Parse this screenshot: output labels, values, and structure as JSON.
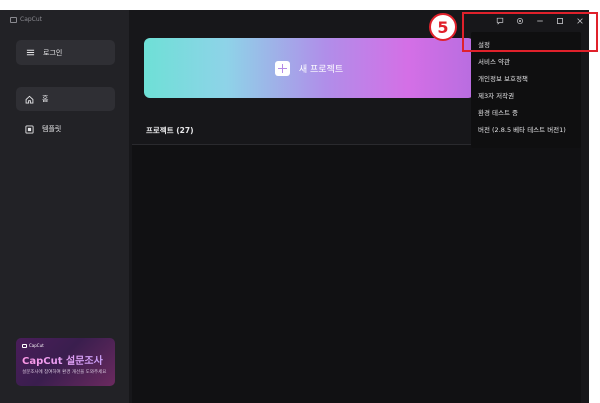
{
  "app": {
    "brand": "CapCut"
  },
  "sidebar": {
    "login_label": "로그인",
    "items": [
      {
        "label": "홈",
        "icon": "home-icon"
      },
      {
        "label": "템플릿",
        "icon": "template-icon"
      }
    ],
    "promo": {
      "brand": "CapCut",
      "title": "CapCut 설문조사",
      "desc": "설문조사에 참여하여 환경 개선을 도와주세요"
    }
  },
  "main": {
    "new_project_label": "새 프로젝트",
    "projects_heading": "프로젝트 (27)"
  },
  "window_controls": [
    "feedback-icon",
    "settings-icon",
    "minimize-icon",
    "maximize-icon",
    "close-icon"
  ],
  "menu": {
    "items": [
      "설정",
      "서비스 약관",
      "개인정보 보호정책",
      "제3자 저작권",
      "환경 테스트 중",
      "버전 (2.8.5 베타 테스트 버전1)"
    ]
  },
  "annotation": {
    "step": "5",
    "color": "#e0212b"
  }
}
